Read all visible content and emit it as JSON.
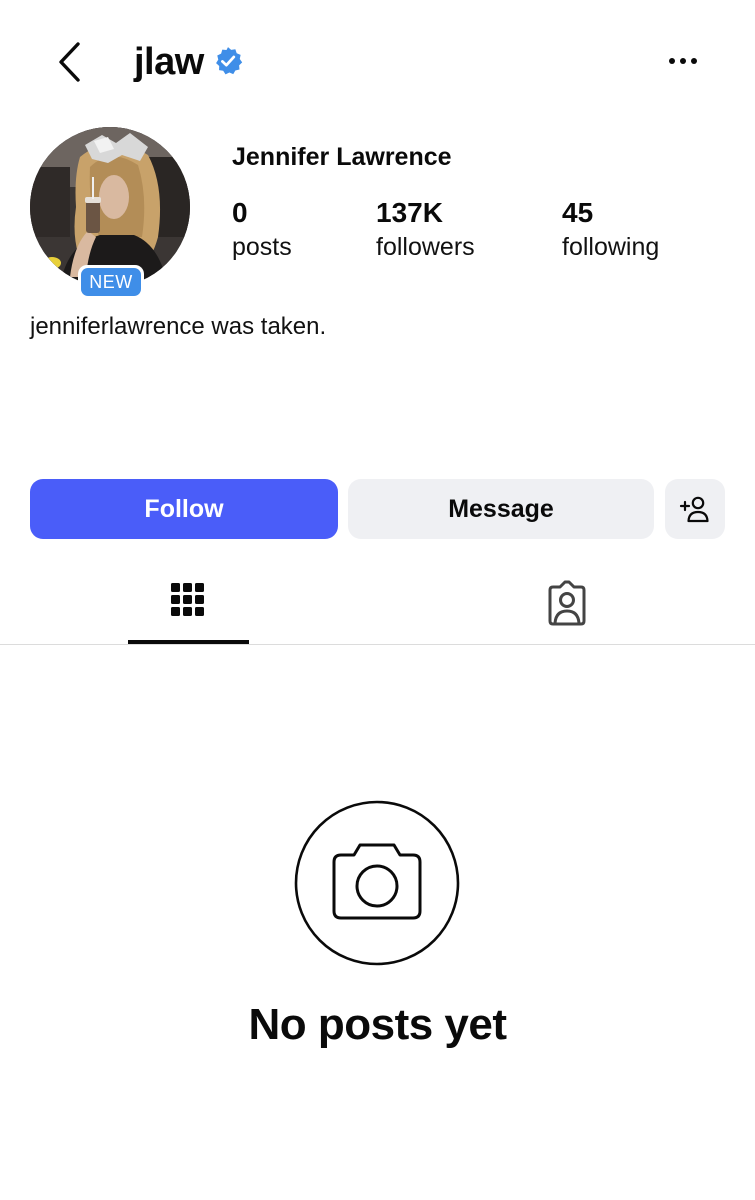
{
  "header": {
    "back_icon": "chevron-left-icon",
    "username": "jlaw",
    "verified_icon": "verified-badge-icon",
    "more_icon": "more-horizontal-icon"
  },
  "profile": {
    "avatar_icon": "profile-photo",
    "new_badge": "NEW",
    "full_name": "Jennifer Lawrence",
    "stats": [
      {
        "value": "0",
        "label": "posts"
      },
      {
        "value": "137K",
        "label": "followers"
      },
      {
        "value": "45",
        "label": "following"
      }
    ],
    "bio": "jenniferlawrence was taken."
  },
  "actions": {
    "follow_label": "Follow",
    "message_label": "Message",
    "add_user_icon": "add-person-icon"
  },
  "tabs": {
    "grid_icon": "grid-icon",
    "tagged_icon": "tagged-person-icon",
    "active": "grid"
  },
  "empty_state": {
    "icon": "camera-icon",
    "text": "No posts yet"
  },
  "colors": {
    "follow_button": "#4a5df9",
    "secondary_button": "#eff0f3",
    "verified": "#3f8ee8",
    "new_badge": "#3f8ee8"
  }
}
